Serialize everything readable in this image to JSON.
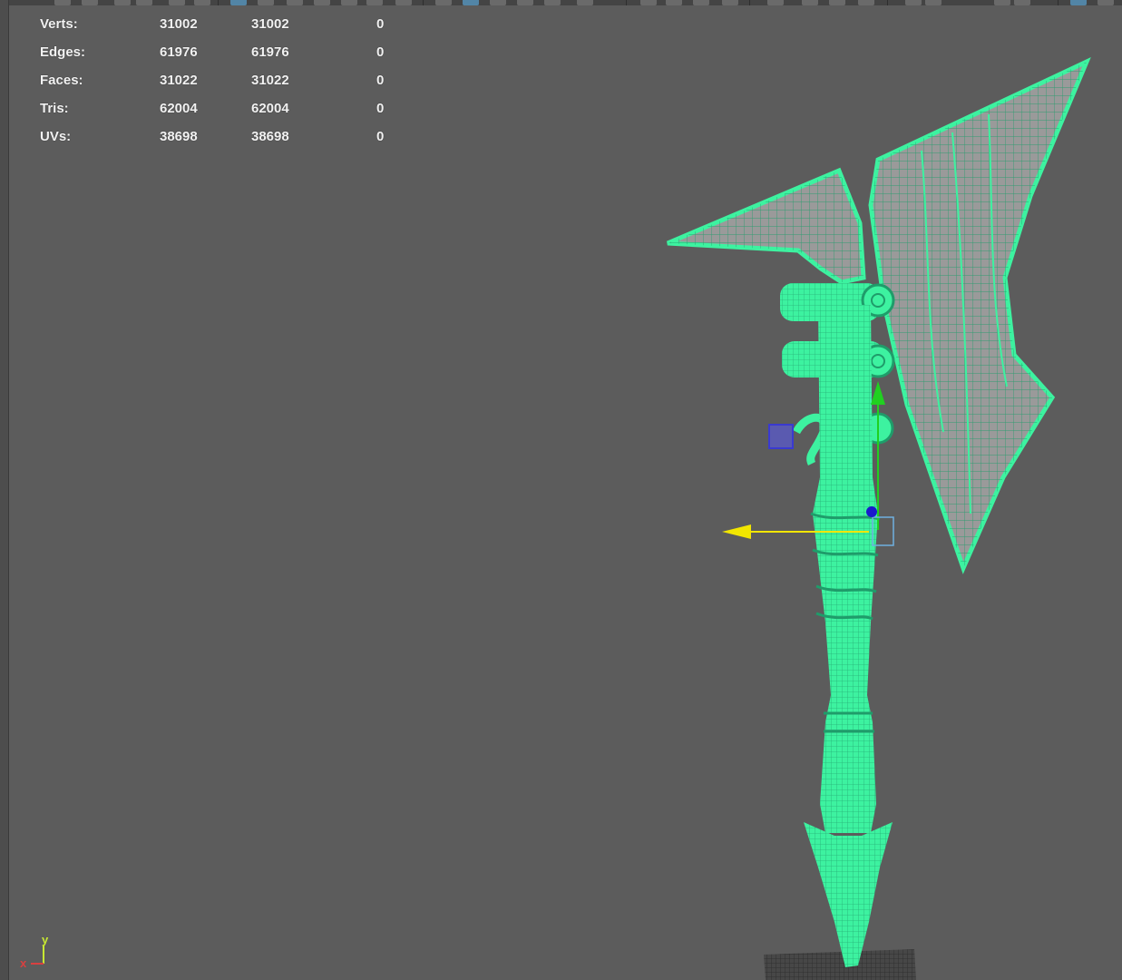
{
  "stats": {
    "rows": [
      {
        "label": "Verts:",
        "v1": "31002",
        "v2": "31002",
        "v3": "0"
      },
      {
        "label": "Edges:",
        "v1": "61976",
        "v2": "61976",
        "v3": "0"
      },
      {
        "label": "Faces:",
        "v1": "31022",
        "v2": "31022",
        "v3": "0"
      },
      {
        "label": "Tris:",
        "v1": "62004",
        "v2": "62004",
        "v3": "0"
      },
      {
        "label": "UVs:",
        "v1": "38698",
        "v2": "38698",
        "v3": "0"
      }
    ]
  },
  "axis_indicator": {
    "x_label": "x",
    "y_label": "y"
  },
  "colors": {
    "wireframe": "#3df2a0",
    "wire_lines": "#1f9c6a",
    "face_shade": "#9a9a9a",
    "manip_x": "#f2e600",
    "manip_y": "#20d020",
    "manip_z": "#1a1acc",
    "viewport_bg": "#5c5c5c"
  },
  "icons": {
    "toolbar": [
      "select-tool-icon",
      "lasso-icon",
      "paint-icon",
      "move-icon",
      "rotate-icon",
      "scale-icon",
      "layout-single-icon",
      "layout-four-icon",
      "camera-icon",
      "wireframe-icon",
      "shaded-icon",
      "textured-icon",
      "lights-icon",
      "shadows-icon",
      "isolate-icon",
      "xray-icon"
    ]
  }
}
